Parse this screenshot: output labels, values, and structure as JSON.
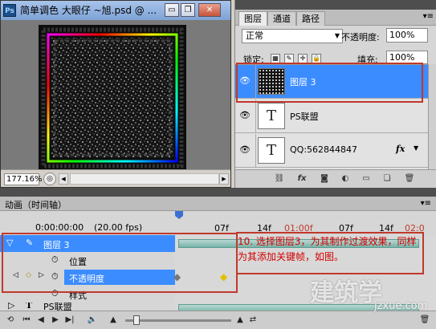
{
  "document": {
    "title": "简单调色 大眼仔 ~旭.psd @ ...",
    "app_icon": "Ps",
    "zoom": "177.16%"
  },
  "window_buttons": {
    "minimize": "▭",
    "restore": "❐",
    "close": "✕"
  },
  "layers_panel": {
    "tabs": [
      {
        "label": "图层",
        "active": true
      },
      {
        "label": "通道",
        "active": false
      },
      {
        "label": "路径",
        "active": false
      }
    ],
    "blend_mode": "正常",
    "opacity_label": "不透明度:",
    "opacity_value": "100%",
    "lock_label": "锁定:",
    "fill_label": "填充:",
    "fill_value": "100%",
    "layers": [
      {
        "name": "图层 3",
        "thumb": "noise",
        "selected": true
      },
      {
        "name": "PS联盟",
        "thumb": "T",
        "selected": false
      },
      {
        "name": "QQ:562844847",
        "thumb": "T",
        "selected": false,
        "fx": "fx"
      }
    ],
    "bottom_icons": [
      "link-icon",
      "fx-icon",
      "mask-icon",
      "adjustment-icon",
      "folder-icon",
      "new-layer-icon",
      "trash-icon"
    ]
  },
  "animation_panel": {
    "title": "动画（时间轴）",
    "timecode": "0:00:00:00",
    "fps": "(20.00 fps)",
    "ruler_ticks": [
      {
        "label": "07f",
        "color": "#000000"
      },
      {
        "label": "14f",
        "color": "#000000"
      },
      {
        "label": "01:00f",
        "color": "#c0392b"
      },
      {
        "label": "07f",
        "color": "#000000"
      },
      {
        "label": "14f",
        "color": "#000000"
      },
      {
        "label": "02:0",
        "color": "#c0392b"
      }
    ],
    "rows": [
      {
        "label": "图层 3",
        "type": "layer"
      },
      {
        "label": "位置",
        "type": "property"
      },
      {
        "label": "不透明度",
        "type": "property",
        "selected": true
      },
      {
        "label": "样式",
        "type": "property"
      },
      {
        "label": "PS联盟",
        "type": "layer"
      }
    ],
    "annotation": "10. 选择图层3，为其制作过渡效果，同样为其添加关键帧，如图。"
  },
  "watermark": {
    "main": "建筑学",
    "sub": "jzxue.com"
  },
  "colors": {
    "selection": "#3b8cff",
    "annotation": "#d40000",
    "titlebar": "#a8c4ea"
  }
}
